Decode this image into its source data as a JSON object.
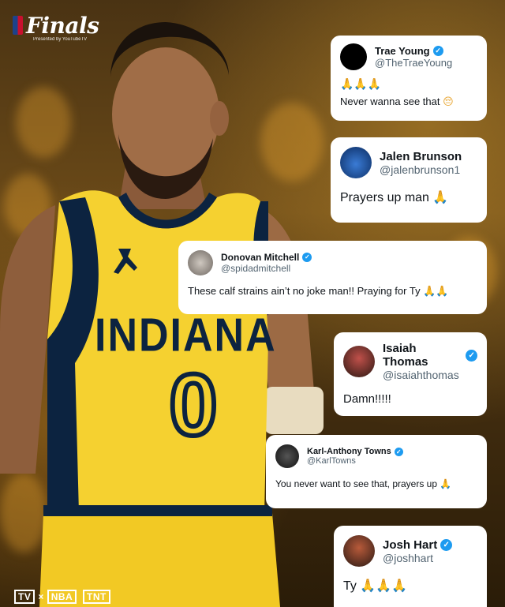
{
  "branding": {
    "finals_title": "Finals",
    "presented_by": "Presented by YouTubeTV",
    "network_logos": [
      "TV",
      "NBA",
      "TNT"
    ]
  },
  "jersey": {
    "team": "INDIANA",
    "number": "0",
    "colors": {
      "primary": "#f5d130",
      "secondary": "#0c2340"
    }
  },
  "tweets": [
    {
      "name": "Trae Young",
      "handle": "@TheTraeYoung",
      "text": "Never wanna see that",
      "prefix_emoji": "🙏🙏🙏",
      "suffix_emoji": "😔"
    },
    {
      "name": "Jalen Brunson",
      "handle": "@jalenbrunson1",
      "text": "Prayers up man",
      "suffix_emoji": "🙏"
    },
    {
      "name": "Donovan Mitchell",
      "handle": "@spidadmitchell",
      "text": "These calf strains ain’t no joke man!! Praying for Ty",
      "suffix_emoji": "🙏🙏"
    },
    {
      "name": "Isaiah Thomas",
      "handle": "@isaiahthomas",
      "text": "Damn!!!!!"
    },
    {
      "name": "Karl-Anthony Towns",
      "handle": "@KarlTowns",
      "text": "You never want to see that, prayers up",
      "suffix_emoji": "🙏"
    },
    {
      "name": "Josh Hart",
      "handle": "@joshhart",
      "text": "Ty",
      "suffix_emoji": "🙏🙏🙏"
    }
  ],
  "colors": {
    "verified_blue": "#1d9bf0",
    "handle_gray": "#536471"
  }
}
